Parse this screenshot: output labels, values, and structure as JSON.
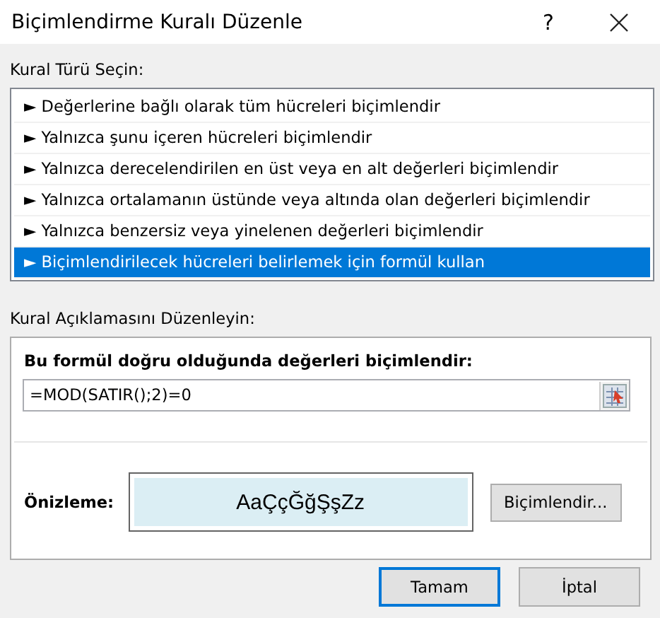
{
  "window": {
    "title": "Biçimlendirme Kuralı Düzenle",
    "help": "?"
  },
  "rule_type": {
    "label": "Kural Türü Seçin:",
    "items": [
      {
        "bullet": "►",
        "label": "Değerlerine bağlı olarak tüm hücreleri biçimlendir",
        "selected": false
      },
      {
        "bullet": "►",
        "label": "Yalnızca şunu içeren hücreleri biçimlendir",
        "selected": false
      },
      {
        "bullet": "►",
        "label": "Yalnızca derecelendirilen en üst veya en alt değerleri biçimlendir",
        "selected": false
      },
      {
        "bullet": "►",
        "label": "Yalnızca ortalamanın üstünde veya altında olan değerleri biçimlendir",
        "selected": false
      },
      {
        "bullet": "►",
        "label": "Yalnızca benzersiz veya yinelenen değerleri biçimlendir",
        "selected": false
      },
      {
        "bullet": "►",
        "label": "Biçimlendirilecek hücreleri belirlemek için formül kullan",
        "selected": true
      }
    ]
  },
  "description": {
    "label": "Kural Açıklamasını Düzenleyin:",
    "formula_label": "Bu formül doğru olduğunda değerleri biçimlendir:",
    "formula": "=MOD(SATIR();2)=0",
    "preview_label": "Önizleme:",
    "preview_text": "AaÇçĞğŞşZz",
    "format_button": "Biçimlendir..."
  },
  "buttons": [
    {
      "label": "Tamam",
      "default": true
    },
    {
      "label": "İptal",
      "default": false
    }
  ]
}
